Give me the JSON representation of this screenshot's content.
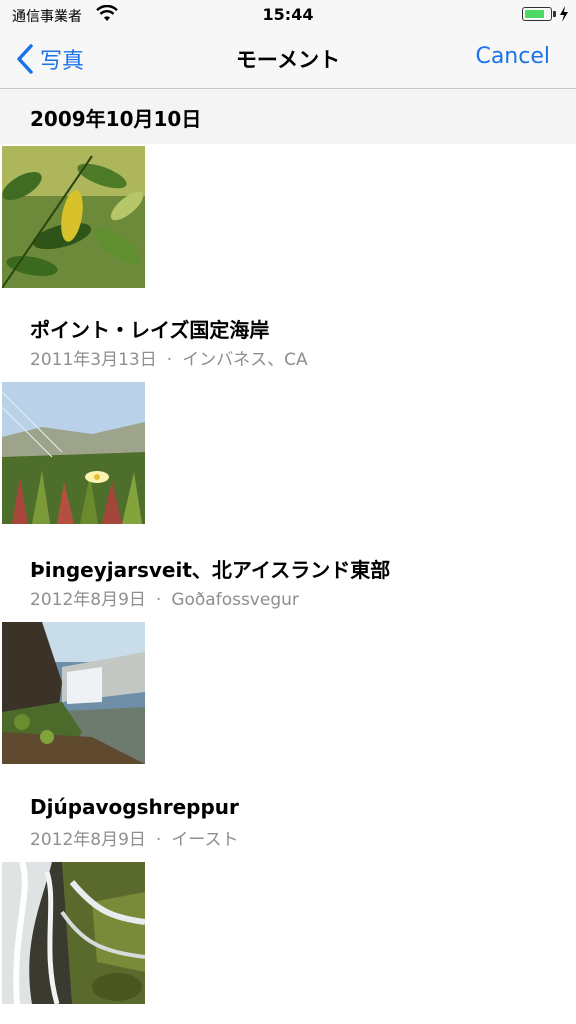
{
  "status_bar": {
    "carrier": "通信事業者",
    "time": "15:44",
    "battery_level": 0.8,
    "icons": [
      "wifi-icon",
      "battery-icon",
      "charging-bolt-icon"
    ]
  },
  "nav": {
    "back_label": "写真",
    "title": "モーメント",
    "cancel_label": "Cancel",
    "accent_color": "#1a73e8"
  },
  "sections": [
    {
      "header": "2009年10月10日"
    },
    {
      "title": "ポイント・レイズ国定海岸",
      "date": "2011年3月13日",
      "separator": "·",
      "place": "インバネス、CA"
    },
    {
      "title": "Þingeyjarsveit、北アイスランド東部",
      "date": "2012年8月9日",
      "separator": "·",
      "place": "Goðafossvegur"
    },
    {
      "title": "Djúpavogshreppur",
      "date": "2012年8月9日",
      "separator": "·",
      "place": "イースト"
    }
  ]
}
